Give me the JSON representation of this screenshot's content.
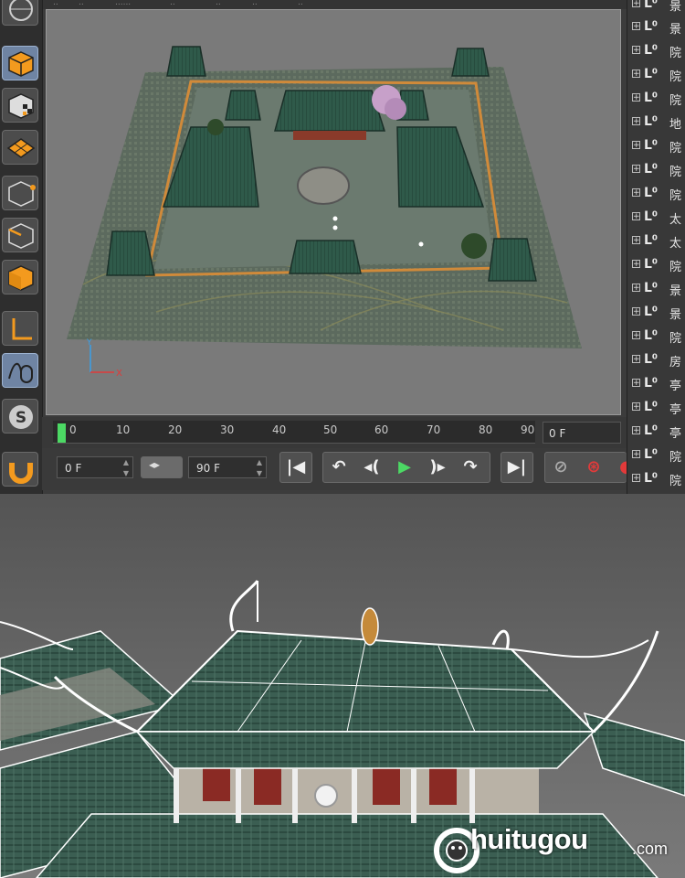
{
  "menu": {
    "items": [
      "..",
      "..",
      "......",
      "..",
      "..",
      "..",
      ".."
    ]
  },
  "toolbar": {
    "tools": [
      "view-cube-tool",
      "checker-cube-tool",
      "grid-tool",
      "point-mode-tool",
      "edge-mode-tool",
      "polygon-mode-tool",
      "axis-tool",
      "sculpt-tool",
      "snap-tool",
      "magnet-tool"
    ]
  },
  "timeline": {
    "ticks": [
      "0",
      "10",
      "20",
      "30",
      "40",
      "50",
      "60",
      "70",
      "80",
      "90"
    ],
    "current_frame": "0 F",
    "playhead_percent": 0
  },
  "transport": {
    "start_frame": "0 F",
    "end_frame": "90 F"
  },
  "object_manager": {
    "items": [
      {
        "label": "景"
      },
      {
        "label": "院"
      },
      {
        "label": "院"
      },
      {
        "label": "院"
      },
      {
        "label": "地"
      },
      {
        "label": "院"
      },
      {
        "label": "院"
      },
      {
        "label": "院"
      },
      {
        "label": "太"
      },
      {
        "label": "太"
      },
      {
        "label": "院"
      },
      {
        "label": "景"
      },
      {
        "label": "景"
      },
      {
        "label": "院"
      },
      {
        "label": "房"
      },
      {
        "label": "亭"
      },
      {
        "label": "亭"
      },
      {
        "label": "亭"
      },
      {
        "label": "院"
      },
      {
        "label": "院"
      }
    ]
  },
  "watermark": {
    "brand": "huitugou",
    "suffix": ".com",
    "letter": "C"
  },
  "colors": {
    "accent_orange": "#f39a1e",
    "playhead_green": "#4cd964",
    "roof_green": "#3f6b5a"
  }
}
